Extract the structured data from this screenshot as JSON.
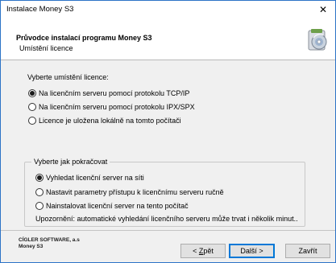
{
  "window": {
    "title": "Instalace Money S3",
    "close_glyph": "✕"
  },
  "header": {
    "title": "Průvodce instalací programu Money S3",
    "subtitle": "Umístění licence",
    "icon": "installer-disc-icon"
  },
  "license_section": {
    "prompt": "Vyberte umístění licence:",
    "options": [
      {
        "label": "Na licenčním serveru pomocí protokolu TCP/IP",
        "checked": true
      },
      {
        "label": "Na licenčním serveru pomocí protokolu IPX/SPX",
        "checked": false
      },
      {
        "label": "Licence je uložena lokálně na tomto počítači",
        "checked": false
      }
    ]
  },
  "continue_group": {
    "legend": "Vyberte jak pokračovat",
    "options": [
      {
        "label": "Vyhledat licenční server na síti",
        "checked": true
      },
      {
        "label": "Nastavit parametry přístupu k licenčnímu serveru ručně",
        "checked": false
      },
      {
        "label": "Nainstalovat licenční server na tento počítač",
        "checked": false
      }
    ],
    "warning": "Upozornění: automatické vyhledání licenčního serveru může trvat i několik minut.."
  },
  "footer": {
    "company_line1": "CÍGLER SOFTWARE, a.s",
    "company_line2": "Money S3",
    "back_prefix": "< ",
    "back_mnemonic": "Z",
    "back_rest": "pět",
    "next_label": "Další >",
    "close_label": "Zavřít"
  },
  "colors": {
    "accent": "#0078d7",
    "title_border": "#2c73c7"
  }
}
